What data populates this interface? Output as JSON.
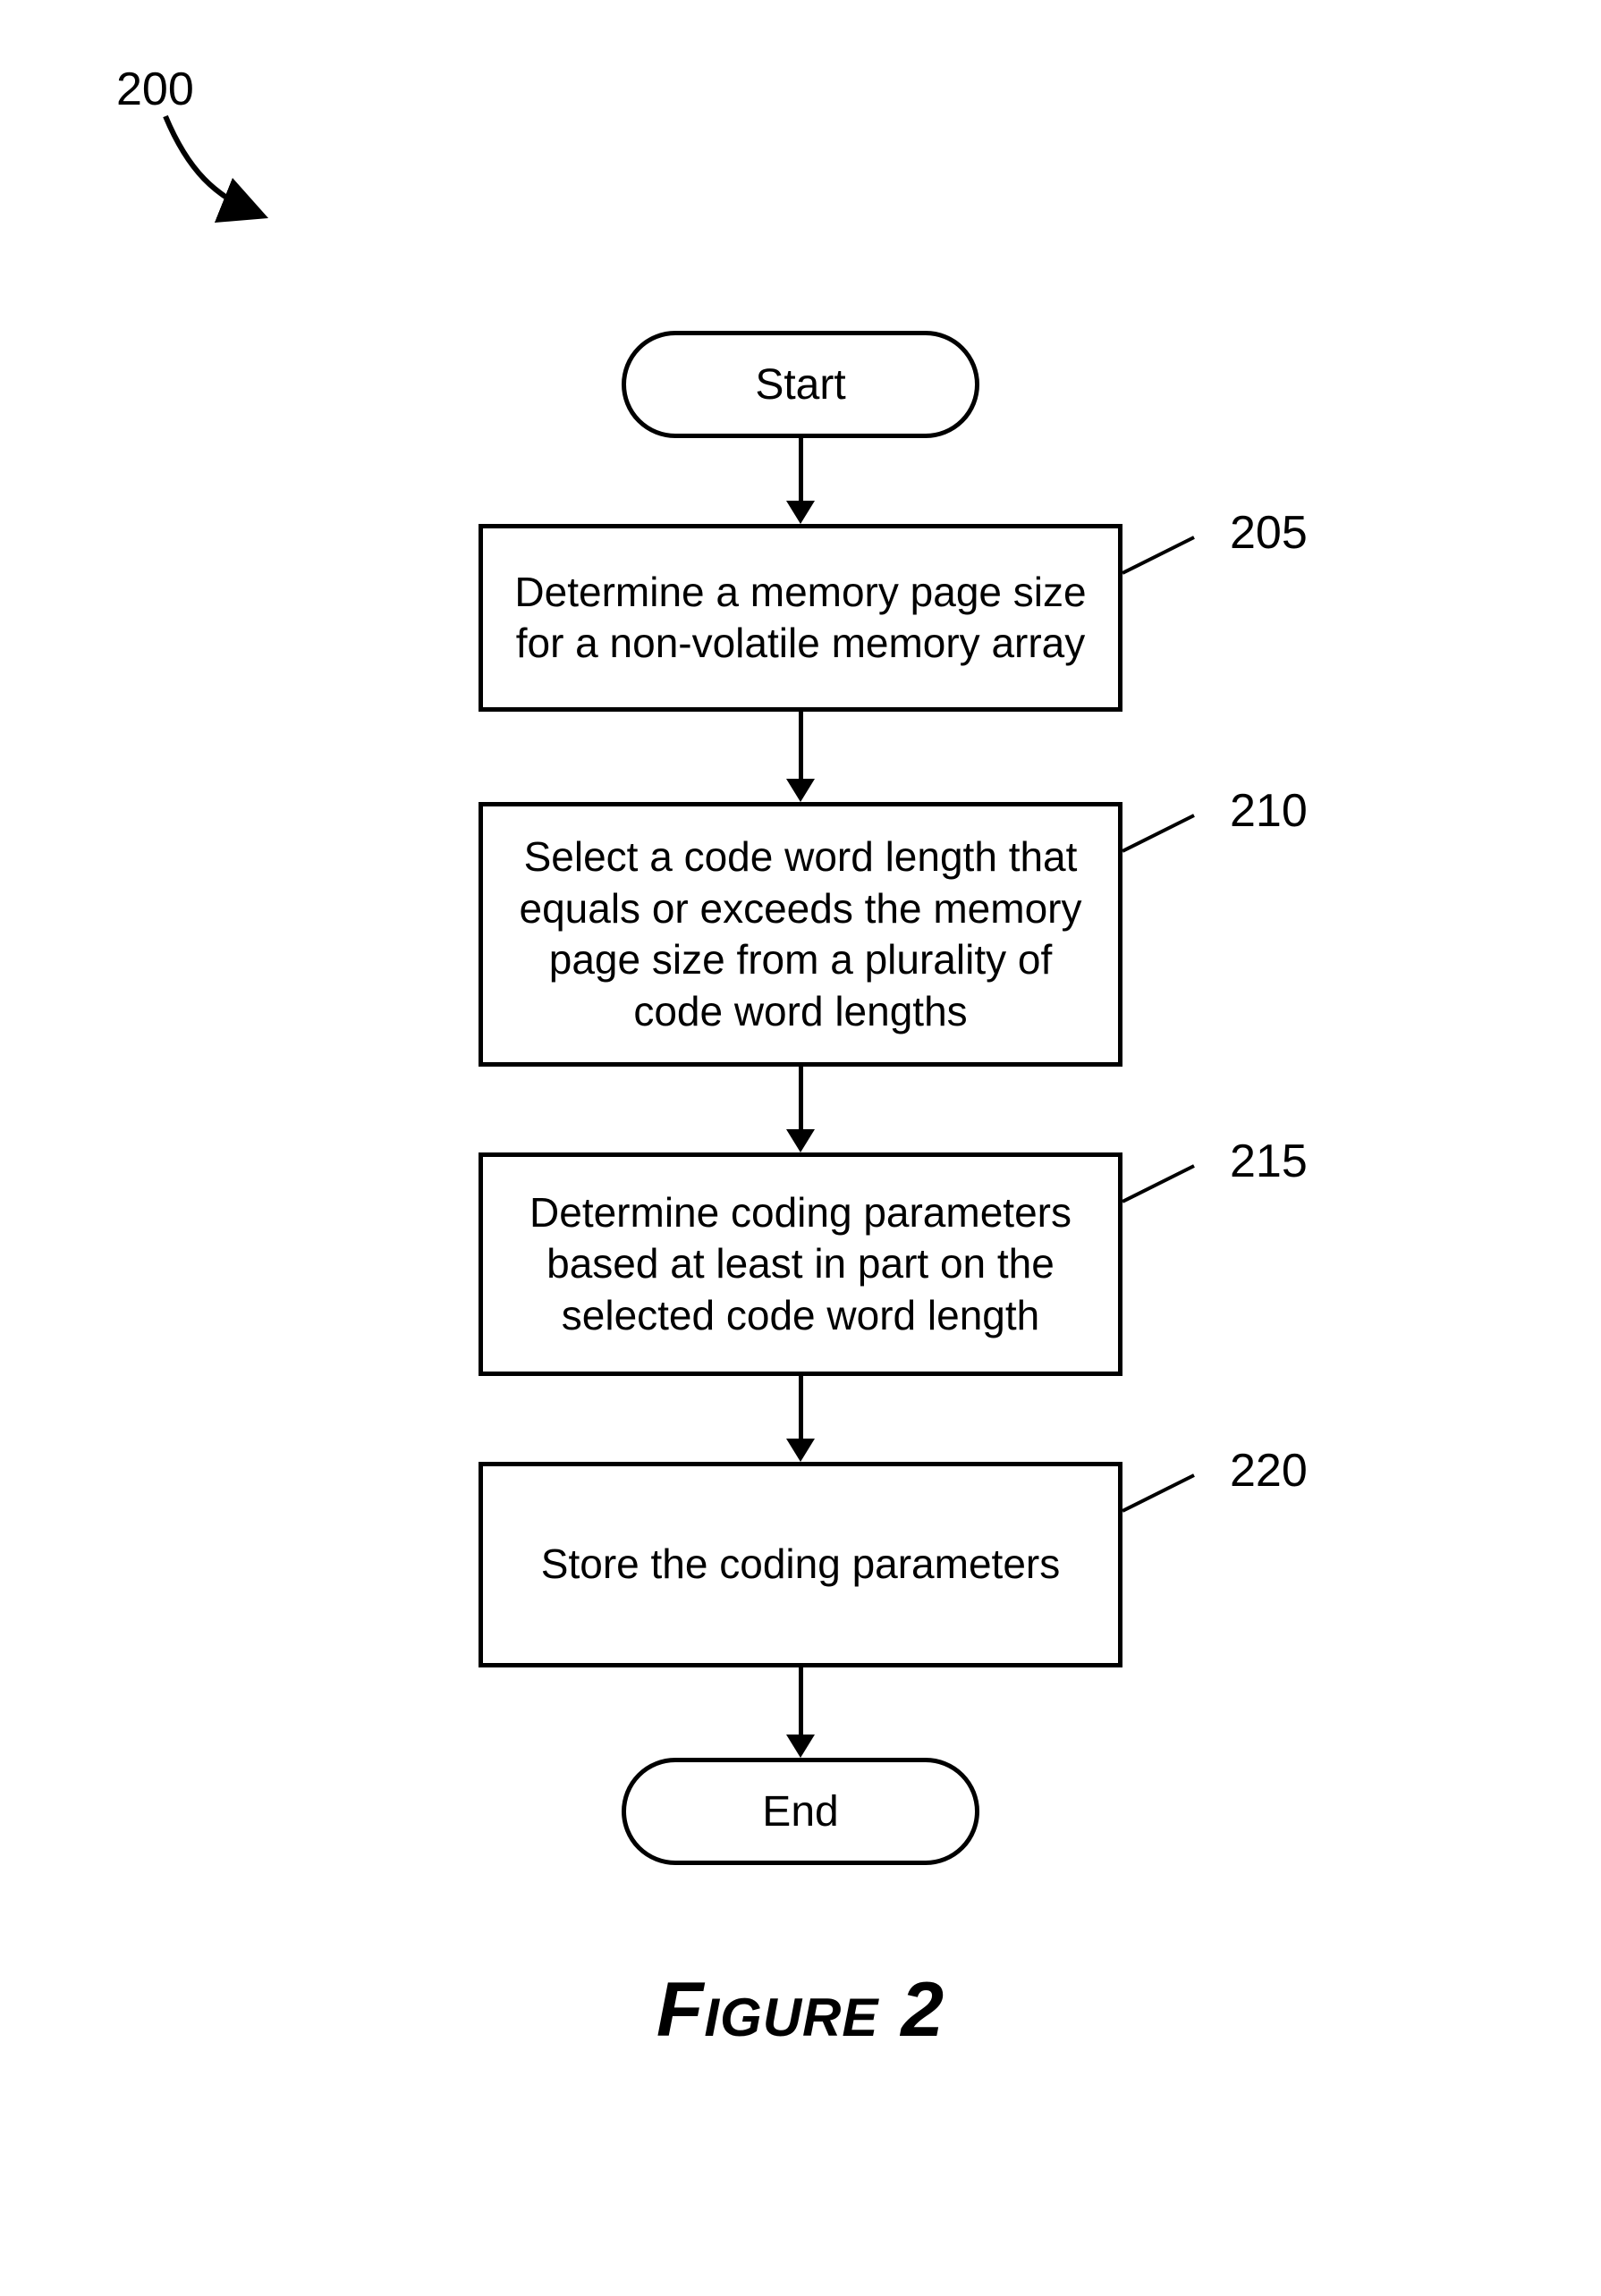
{
  "figure_ref": "200",
  "terminators": {
    "start": "Start",
    "end": "End"
  },
  "steps": [
    {
      "num": "205",
      "text": "Determine a memory page size for a non-volatile memory array"
    },
    {
      "num": "210",
      "text": "Select a code word length that equals or exceeds the memory page size from a plurality of code word lengths"
    },
    {
      "num": "215",
      "text": "Determine coding parameters based at least in part on the selected code word length"
    },
    {
      "num": "220",
      "text": "Store the coding parameters"
    }
  ],
  "caption": "Figure 2"
}
